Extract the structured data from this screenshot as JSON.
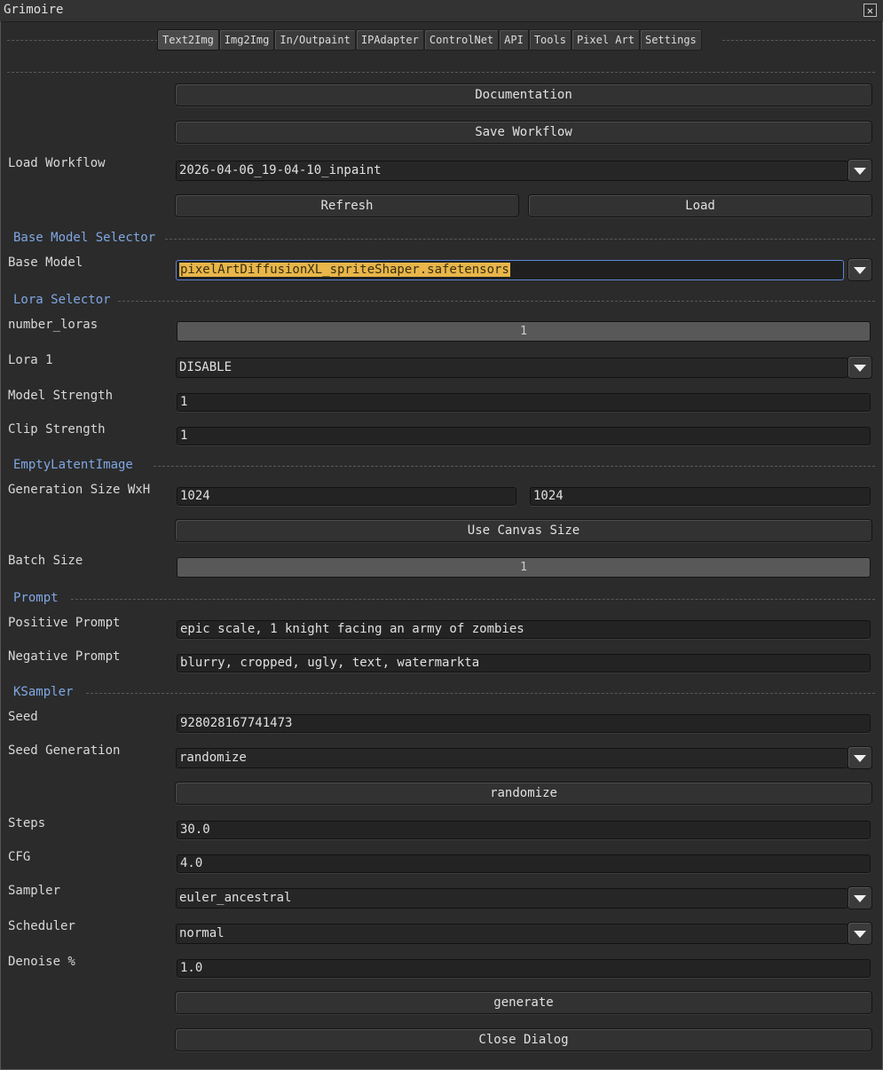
{
  "window": {
    "title": "Grimoire",
    "close_symbol": "✕"
  },
  "tabs": [
    "Text2Img",
    "Img2Img",
    "In/Outpaint",
    "IPAdapter",
    "ControlNet",
    "API",
    "Tools",
    "Pixel Art",
    "Settings"
  ],
  "buttons": {
    "documentation": "Documentation",
    "save_workflow": "Save Workflow",
    "refresh": "Refresh",
    "load": "Load",
    "use_canvas_size": "Use Canvas Size",
    "randomize": "randomize",
    "generate": "generate",
    "close_dialog": "Close Dialog"
  },
  "sections": {
    "base_model": "Base Model Selector",
    "lora": "Lora Selector",
    "latent": "EmptyLatentImage",
    "prompt": "Prompt",
    "ksampler": "KSampler"
  },
  "labels": {
    "load_workflow": "Load Workflow",
    "base_model": "Base Model",
    "number_loras": "number_loras",
    "lora_1": "Lora 1",
    "model_strength": "Model Strength",
    "clip_strength": "Clip Strength",
    "generation_size": "Generation Size WxH",
    "batch_size": "Batch Size",
    "positive_prompt": "Positive Prompt",
    "negative_prompt": "Negative Prompt",
    "seed": "Seed",
    "seed_generation": "Seed Generation",
    "steps": "Steps",
    "cfg": "CFG",
    "sampler": "Sampler",
    "scheduler": "Scheduler",
    "denoise": "Denoise %"
  },
  "values": {
    "workflow": "2026-04-06_19-04-10_inpaint",
    "base_model": "pixelArtDiffusionXL_spriteShaper.safetensors",
    "number_loras": "1",
    "lora_1": "DISABLE",
    "model_strength": "1",
    "clip_strength": "1",
    "width": "1024",
    "height": "1024",
    "batch_size": "1",
    "positive_prompt": "epic scale, 1 knight facing an army of zombies",
    "negative_prompt": "blurry, cropped, ugly, text, watermarkta",
    "seed": "928028167741473",
    "seed_generation": "randomize",
    "steps": "30.0",
    "cfg": "4.0",
    "sampler": "euler_ancestral",
    "scheduler": "normal",
    "denoise": "1.0"
  },
  "colors": {
    "accent": "#7fa7e3",
    "selection": "#e8b64a",
    "background": "#2b2b2b"
  }
}
